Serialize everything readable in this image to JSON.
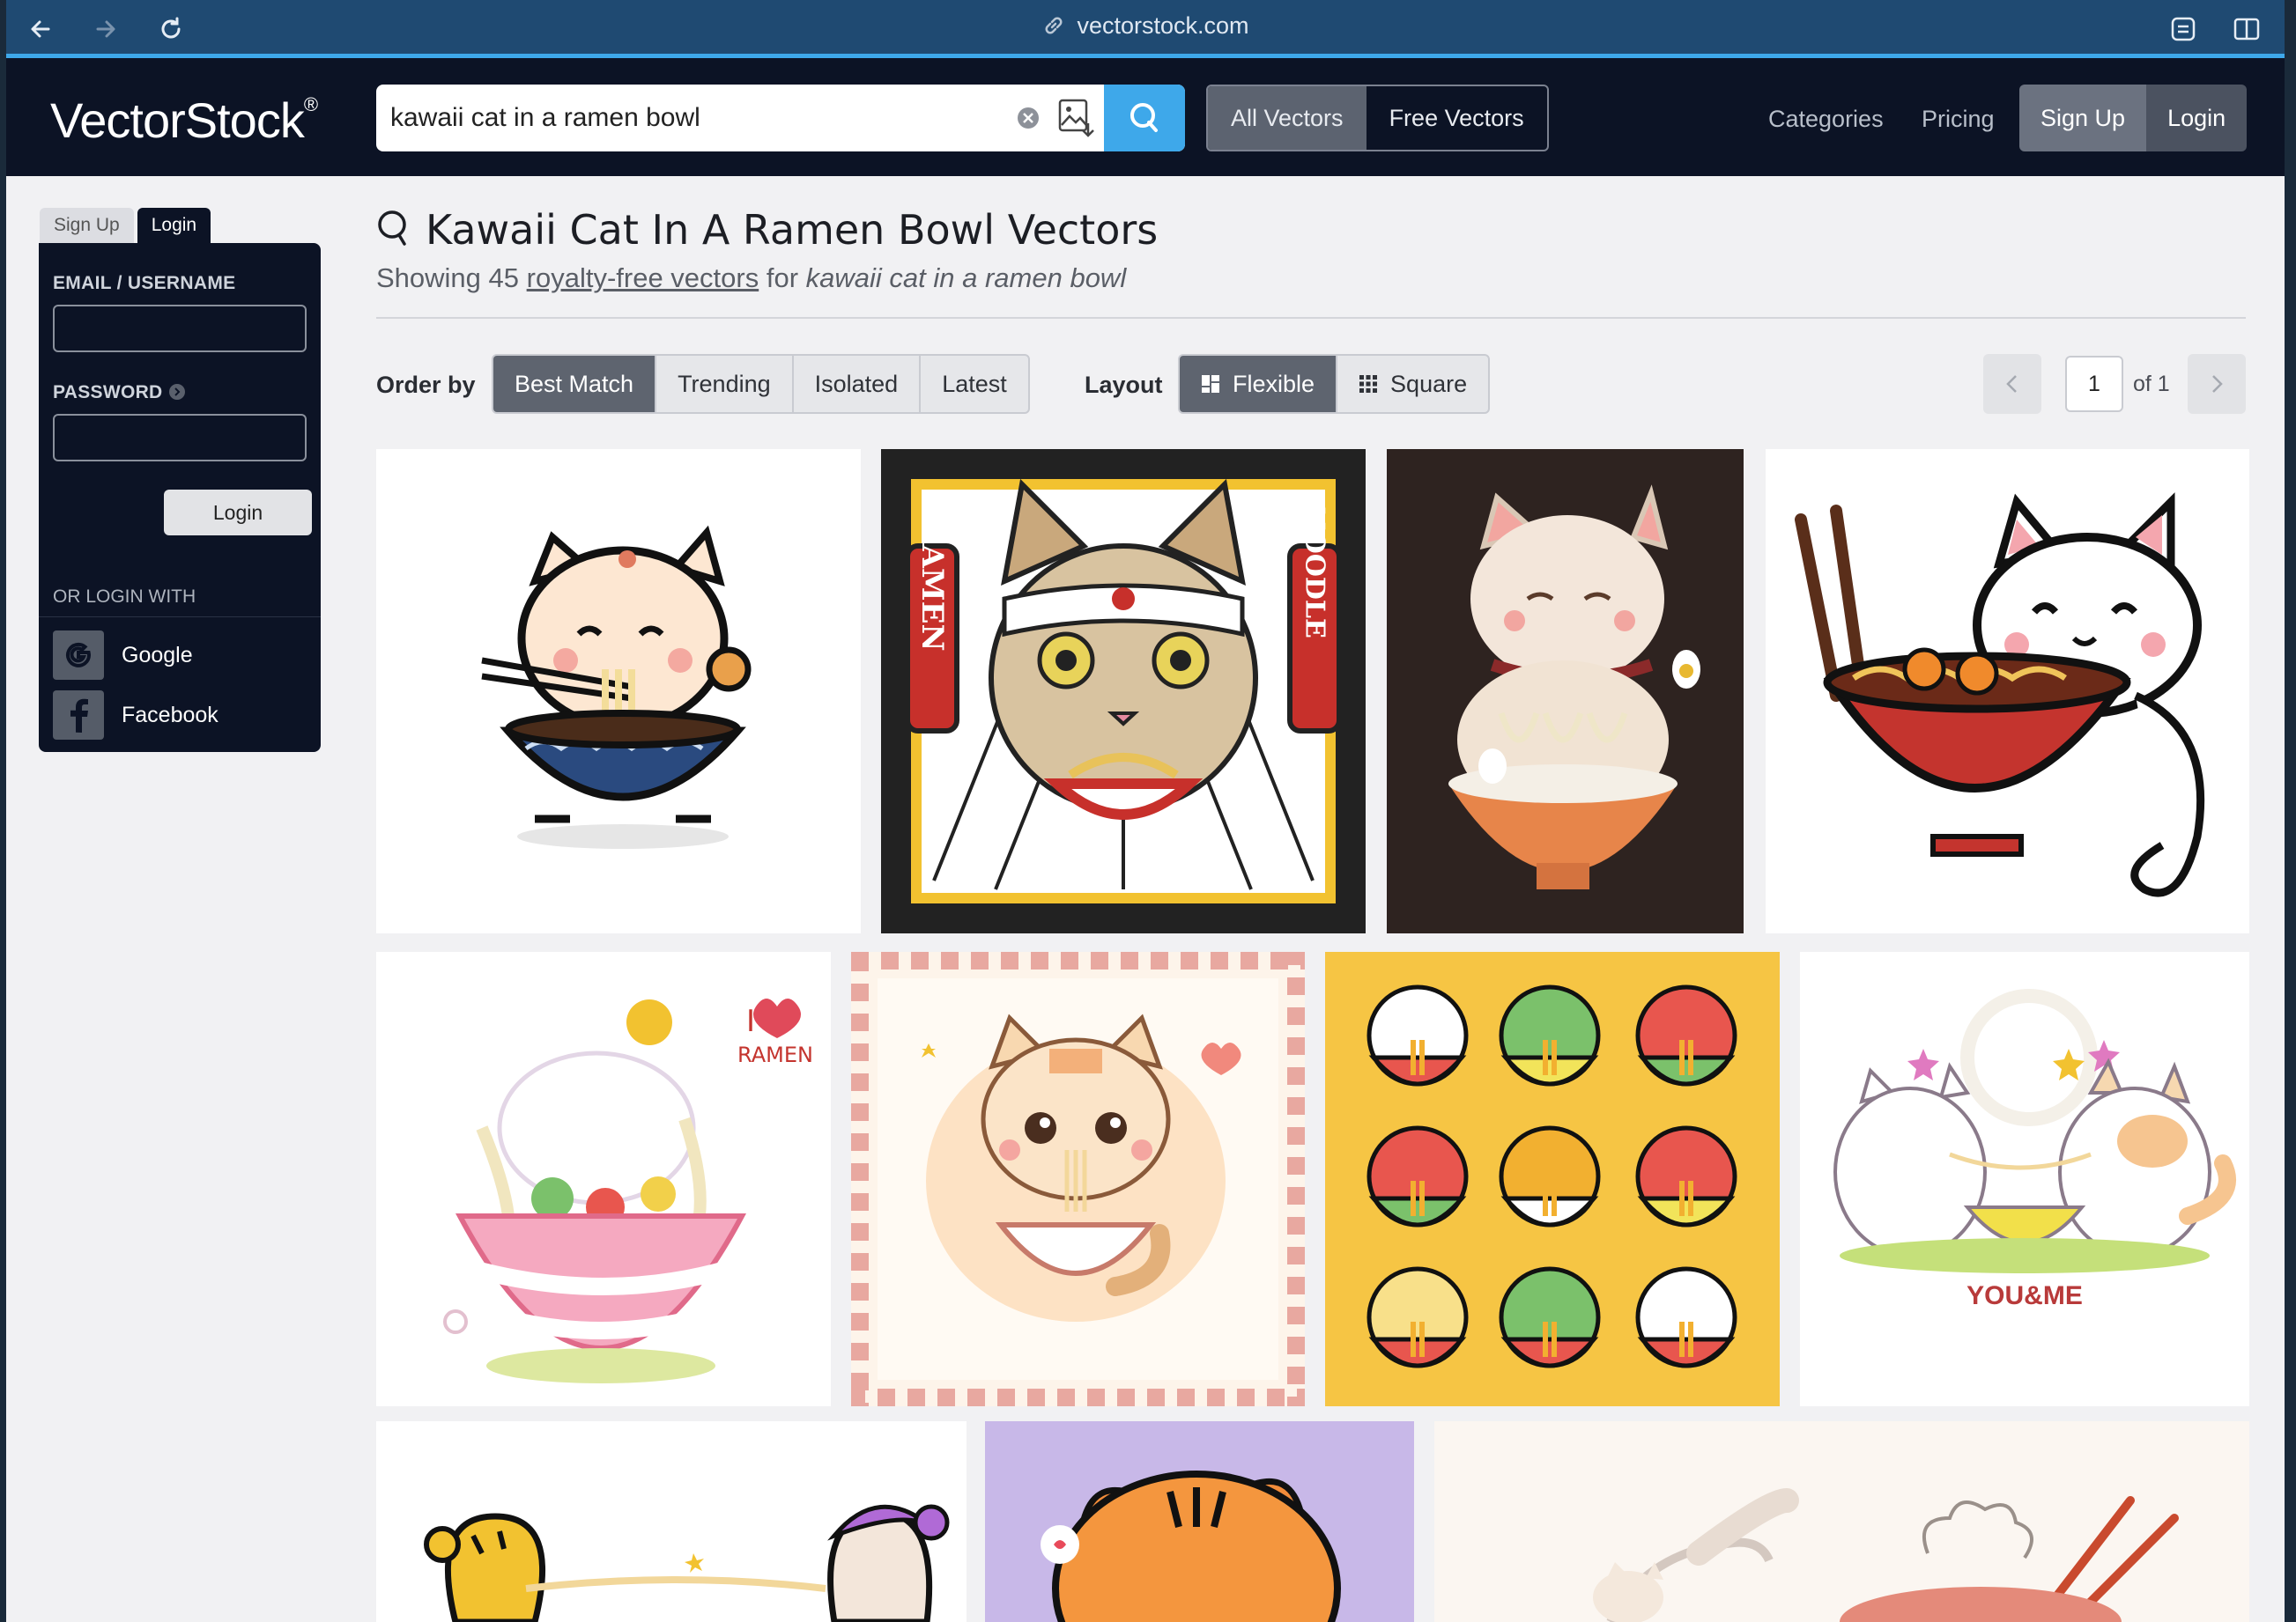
{
  "browser": {
    "url": "vectorstock.com"
  },
  "header": {
    "logo": "VectorStock",
    "logo_reg": "®",
    "search_value": "kawaii cat in a ramen bowl",
    "vector_types": [
      "All Vectors",
      "Free Vectors"
    ],
    "nav": [
      "Categories",
      "Pricing"
    ],
    "signup_label": "Sign Up",
    "login_label": "Login"
  },
  "login_panel": {
    "tabs": [
      "Sign Up",
      "Login"
    ],
    "email_label": "EMAIL / USERNAME",
    "password_label": "PASSWORD",
    "login_button": "Login",
    "or_login_with": "OR LOGIN WITH",
    "google": "Google",
    "facebook": "Facebook"
  },
  "results": {
    "title": "Kawaii Cat In A Ramen Bowl Vectors",
    "showing_prefix": "Showing 45",
    "showing_link": "royalty-free vectors",
    "showing_for": "for",
    "query": "kawaii cat in a ramen bowl"
  },
  "toolbar": {
    "order_label": "Order by",
    "order_options": [
      "Best Match",
      "Trending",
      "Isolated",
      "Latest"
    ],
    "order_selected": "Best Match",
    "layout_label": "Layout",
    "layout_options": [
      "Flexible",
      "Square"
    ],
    "layout_selected": "Flexible",
    "page": "1",
    "page_of": "of 1"
  },
  "gallery": {
    "tile_texts": {
      "ramen_left": "RAMEN",
      "noodle_right": "NOODLE",
      "i_ramen_i": "I",
      "i_ramen_word": "RAMEN",
      "you_me": "YOU&ME"
    }
  }
}
